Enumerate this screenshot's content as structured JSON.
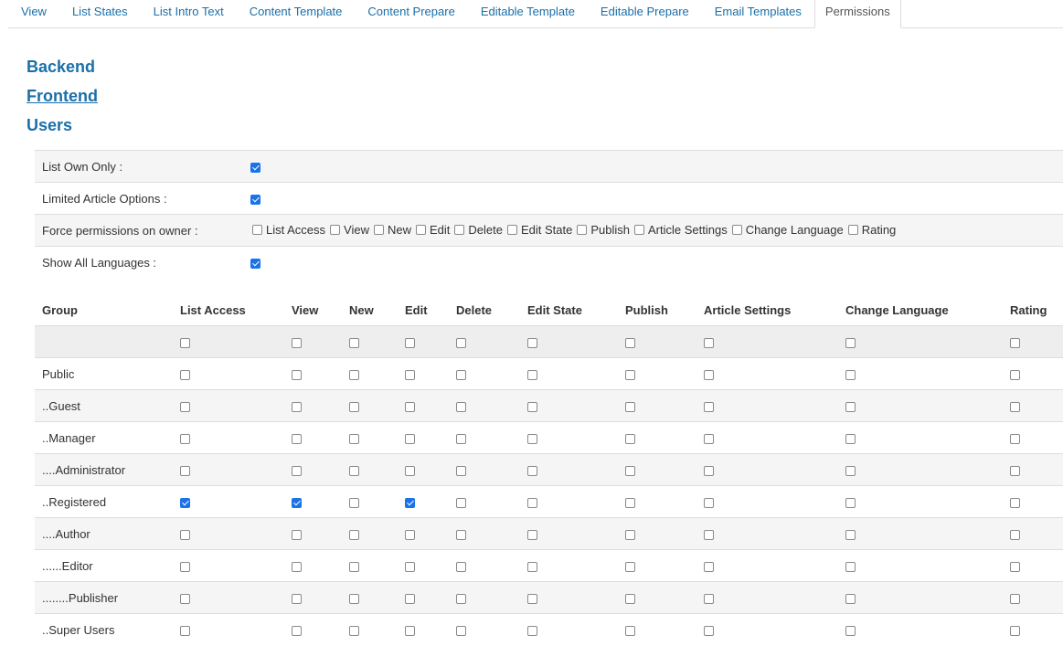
{
  "tabs": [
    "View",
    "List States",
    "List Intro Text",
    "Content Template",
    "Content Prepare",
    "Editable Template",
    "Editable Prepare",
    "Email Templates",
    "Permissions"
  ],
  "active_tab": "Permissions",
  "sections": {
    "backend": "Backend",
    "frontend": "Frontend",
    "users": "Users"
  },
  "options": {
    "list_own_only": {
      "label": "List Own Only :",
      "checked": true
    },
    "limited_article_options": {
      "label": "Limited Article Options :",
      "checked": true
    },
    "force_permissions": {
      "label": "Force permissions on owner :",
      "items": [
        {
          "label": "List Access",
          "checked": false
        },
        {
          "label": "View",
          "checked": false
        },
        {
          "label": "New",
          "checked": false
        },
        {
          "label": "Edit",
          "checked": false
        },
        {
          "label": "Delete",
          "checked": false
        },
        {
          "label": "Edit State",
          "checked": false
        },
        {
          "label": "Publish",
          "checked": false
        },
        {
          "label": "Article Settings",
          "checked": false
        },
        {
          "label": "Change Language",
          "checked": false
        },
        {
          "label": "Rating",
          "checked": false
        }
      ]
    },
    "show_all_languages": {
      "label": "Show All Languages :",
      "checked": true
    }
  },
  "permissions_table": {
    "columns": [
      "Group",
      "List Access",
      "View",
      "New",
      "Edit",
      "Delete",
      "Edit State",
      "Publish",
      "Article Settings",
      "Change Language",
      "Rating"
    ],
    "rows": [
      {
        "group": "Public",
        "checks": [
          false,
          false,
          false,
          false,
          false,
          false,
          false,
          false,
          false,
          false
        ]
      },
      {
        "group": "..Guest",
        "checks": [
          false,
          false,
          false,
          false,
          false,
          false,
          false,
          false,
          false,
          false
        ]
      },
      {
        "group": "..Manager",
        "checks": [
          false,
          false,
          false,
          false,
          false,
          false,
          false,
          false,
          false,
          false
        ]
      },
      {
        "group": "....Administrator",
        "checks": [
          false,
          false,
          false,
          false,
          false,
          false,
          false,
          false,
          false,
          false
        ]
      },
      {
        "group": "..Registered",
        "checks": [
          true,
          true,
          false,
          true,
          false,
          false,
          false,
          false,
          false,
          false
        ]
      },
      {
        "group": "....Author",
        "checks": [
          false,
          false,
          false,
          false,
          false,
          false,
          false,
          false,
          false,
          false
        ]
      },
      {
        "group": "......Editor",
        "checks": [
          false,
          false,
          false,
          false,
          false,
          false,
          false,
          false,
          false,
          false
        ]
      },
      {
        "group": "........Publisher",
        "checks": [
          false,
          false,
          false,
          false,
          false,
          false,
          false,
          false,
          false,
          false
        ]
      },
      {
        "group": "..Super Users",
        "checks": [
          false,
          false,
          false,
          false,
          false,
          false,
          false,
          false,
          false,
          false
        ]
      }
    ]
  }
}
